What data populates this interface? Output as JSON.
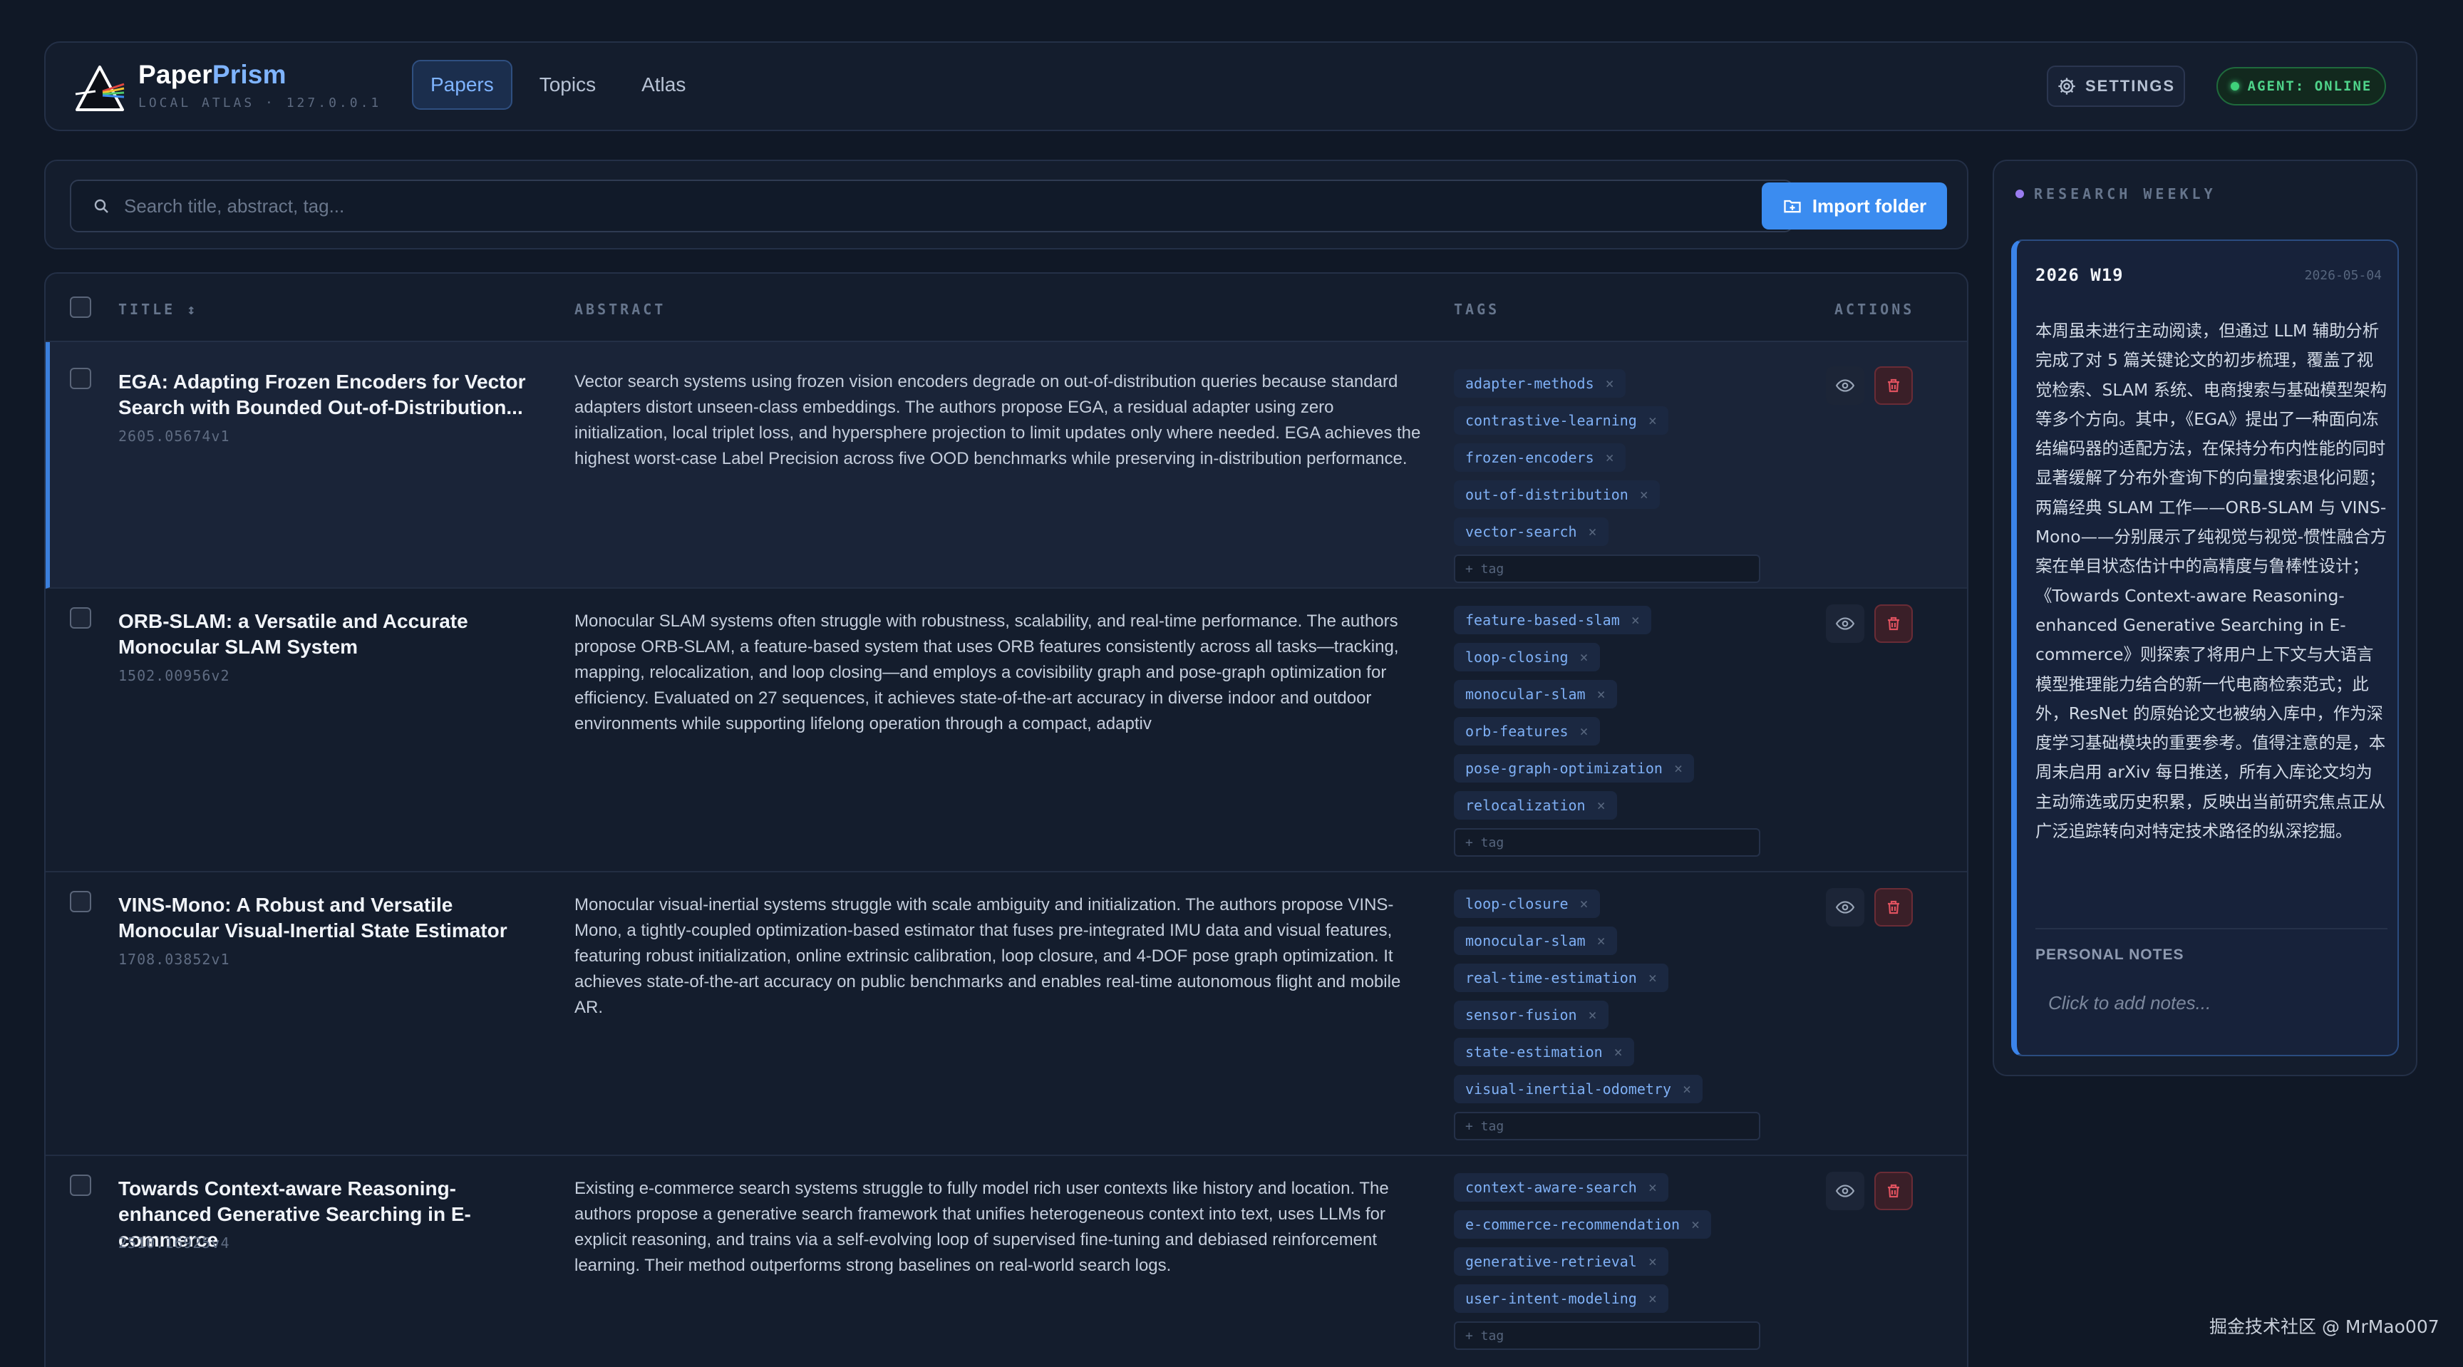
{
  "app": {
    "brand_part1": "Paper",
    "brand_part2": "Prism",
    "subtitle": "LOCAL ATLAS · 127.0.0.1"
  },
  "nav": {
    "tabs": [
      {
        "label": "Papers",
        "active": true
      },
      {
        "label": "Topics",
        "active": false
      },
      {
        "label": "Atlas",
        "active": false
      }
    ]
  },
  "header": {
    "settings_label": "SETTINGS",
    "agent_status": "AGENT: ONLINE"
  },
  "search": {
    "placeholder": "Search title, abstract, tag...",
    "value": "",
    "import_label": "Import folder"
  },
  "table": {
    "columns": {
      "title": "TITLE ↕",
      "abstract": "ABSTRACT",
      "tags": "TAGS",
      "actions": "ACTIONS"
    },
    "add_tag_placeholder": "+ tag",
    "rows": [
      {
        "title": "EGA: Adapting Frozen Encoders for Vector Search with Bounded Out-of-Distribution...",
        "id": "2605.05674v1",
        "abstract": "Vector search systems using frozen vision encoders degrade on out-of-distribution queries because standard adapters distort unseen-class embeddings. The authors propose EGA, a residual adapter using zero initialization, local triplet loss, and hypersphere projection to limit updates only where needed. EGA achieves the highest worst-case Label Precision across five OOD benchmarks while preserving in-distribution performance.",
        "tags": [
          "adapter-methods",
          "contrastive-learning",
          "frozen-encoders",
          "out-of-distribution",
          "vector-search"
        ],
        "selected": true
      },
      {
        "title": "ORB-SLAM: a Versatile and Accurate Monocular SLAM System",
        "id": "1502.00956v2",
        "abstract": "Monocular SLAM systems often struggle with robustness, scalability, and real-time performance. The authors propose ORB-SLAM, a feature-based system that uses ORB features consistently across all tasks—tracking, mapping, relocalization, and loop closing—and employs a covisibility graph and pose-graph optimization for efficiency. Evaluated on 27 sequences, it achieves state-of-the-art accuracy in diverse indoor and outdoor environments while supporting lifelong operation through a compact, adaptiv",
        "tags": [
          "feature-based-slam",
          "loop-closing",
          "monocular-slam",
          "orb-features",
          "pose-graph-optimization",
          "relocalization"
        ],
        "selected": false
      },
      {
        "title": "VINS-Mono: A Robust and Versatile Monocular Visual-Inertial State Estimator",
        "id": "1708.03852v1",
        "abstract": "Monocular visual-inertial systems struggle with scale ambiguity and initialization. The authors propose VINS-Mono, a tightly-coupled optimization-based estimator that fuses pre-integrated IMU data and visual features, featuring robust initialization, online extrinsic calibration, loop closure, and 4-DOF pose graph optimization. It achieves state-of-the-art accuracy on public benchmarks and enables real-time autonomous flight and mobile AR.",
        "tags": [
          "loop-closure",
          "monocular-slam",
          "real-time-estimation",
          "sensor-fusion",
          "state-estimation",
          "visual-inertial-odometry"
        ],
        "selected": false
      },
      {
        "title": "Towards Context-aware Reasoning-enhanced Generative Searching in E-commerce",
        "id": "2510.16925v4",
        "abstract": "Existing e-commerce search systems struggle to fully model rich user contexts like history and location. The authors propose a generative search framework that unifies heterogeneous context into text, uses LLMs for explicit reasoning, and trains via a self-evolving loop of supervised fine-tuning and debiased reinforcement learning. Their method outperforms strong baselines on real-world search logs.",
        "tags": [
          "context-aware-search",
          "e-commerce-recommendation",
          "generative-retrieval",
          "user-intent-modeling"
        ],
        "selected": false
      }
    ]
  },
  "weekly": {
    "heading": "RESEARCH WEEKLY",
    "week_label": "2026 W19",
    "date": "2026-05-04",
    "summary": "本周虽未进行主动阅读，但通过 LLM 辅助分析完成了对 5 篇关键论文的初步梳理，覆盖了视觉检索、SLAM 系统、电商搜索与基础模型架构等多个方向。其中，《EGA》提出了一种面向冻结编码器的适配方法，在保持分布内性能的同时显著缓解了分布外查询下的向量搜索退化问题；两篇经典 SLAM 工作——ORB-SLAM 与 VINS-Mono——分别展示了纯视觉与视觉-惯性融合方案在单目状态估计中的高精度与鲁棒性设计；《Towards Context-aware Reasoning-enhanced Generative Searching in E-commerce》则探索了将用户上下文与大语言模型推理能力结合的新一代电商检索范式；此外，ResNet 的原始论文也被纳入库中，作为深度学习基础模块的重要参考。值得注意的是，本周未启用 arXiv 每日推送，所有入库论文均为主动筛选或历史积累，反映出当前研究焦点正从广泛追踪转向对特定技术路径的纵深挖掘。",
    "notes_label": "PERSONAL NOTES",
    "notes_placeholder": "Click to add notes..."
  },
  "watermark": "掘金技术社区 @ MrMao007",
  "colors": {
    "background": "#101826",
    "panel": "#141d2d",
    "accent": "#3b8cf0",
    "tag_text": "#7fb0f5",
    "online": "#4fd38a",
    "danger": "#e0525f"
  },
  "icons": {
    "logo": "prism-logo-icon",
    "settings": "gear-icon",
    "search": "search-icon",
    "import": "folder-import-icon",
    "view": "eye-icon",
    "delete": "trash-icon",
    "tag_remove": "close-icon"
  }
}
